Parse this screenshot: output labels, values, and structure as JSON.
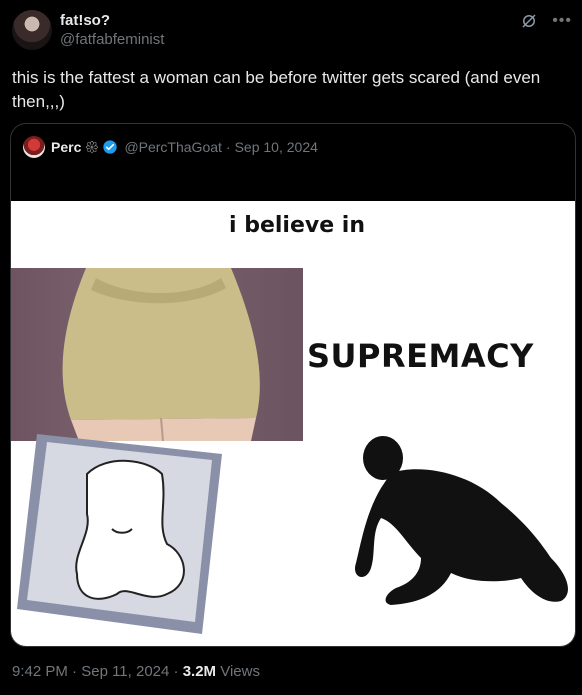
{
  "tweet": {
    "display_name": "fat!so?",
    "handle": "@fatfabfeminist",
    "text": "this is the fattest a woman can be before twitter gets scared (and even then,,,)"
  },
  "quoted_tweet": {
    "display_name": "Perc",
    "emoji": "𑁍",
    "handle": "@PercThaGoat",
    "separator": "·",
    "date": "Sep 10, 2024",
    "meme": {
      "top_text": "i believe in",
      "right_text": "SUPREMACY"
    }
  },
  "meta": {
    "time": "9:42 PM",
    "sep1": "·",
    "date": "Sep 11, 2024",
    "sep2": "·",
    "views_count": "3.2M",
    "views_label": "Views"
  },
  "icons": {
    "grok": "grok-icon",
    "more": "more-icon",
    "verified": "verified-badge-icon"
  },
  "colors": {
    "background": "#000000",
    "text": "#e7e9ea",
    "muted": "#71767b",
    "verified": "#1d9bf0"
  }
}
